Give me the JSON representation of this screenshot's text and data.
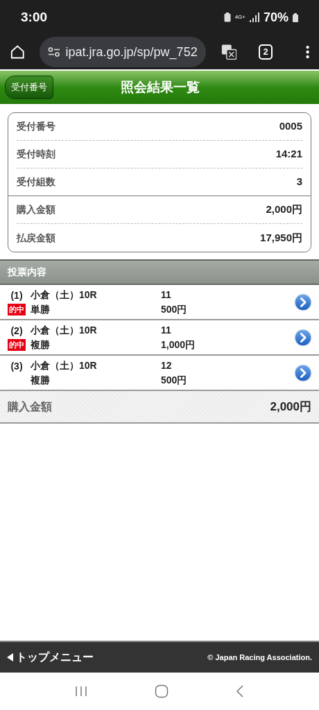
{
  "status_bar": {
    "time": "3:00",
    "network": "4G+",
    "battery": "70%"
  },
  "browser": {
    "url": "ipat.jra.go.jp/sp/pw_752",
    "tab_count": "2"
  },
  "header": {
    "back_button": "受付番号",
    "title": "照会結果一覧"
  },
  "summary": [
    {
      "rows": [
        {
          "label": "受付番号",
          "value": "0005"
        },
        {
          "label": "受付時刻",
          "value": "14:21"
        },
        {
          "label": "受付組数",
          "value": "3"
        }
      ]
    },
    {
      "rows": [
        {
          "label": "購入金額",
          "value": "2,000円"
        },
        {
          "label": "払戻金額",
          "value": "17,950円"
        }
      ]
    }
  ],
  "section_title": "投票内容",
  "bets": [
    {
      "number": "(1)",
      "hit": true,
      "hit_label": "的中",
      "race": "小倉（土）10R",
      "bet_type": "単勝",
      "horse": "11",
      "amount": "500円"
    },
    {
      "number": "(2)",
      "hit": true,
      "hit_label": "的中",
      "race": "小倉（土）10R",
      "bet_type": "複勝",
      "horse": "11",
      "amount": "1,000円"
    },
    {
      "number": "(3)",
      "hit": false,
      "race": "小倉（土）10R",
      "bet_type": "複勝",
      "horse": "12",
      "amount": "500円"
    }
  ],
  "total": {
    "label": "購入金額",
    "value": "2,000円"
  },
  "footer": {
    "menu_link": "トップメニュー",
    "copyright": "© Japan Racing Association."
  }
}
